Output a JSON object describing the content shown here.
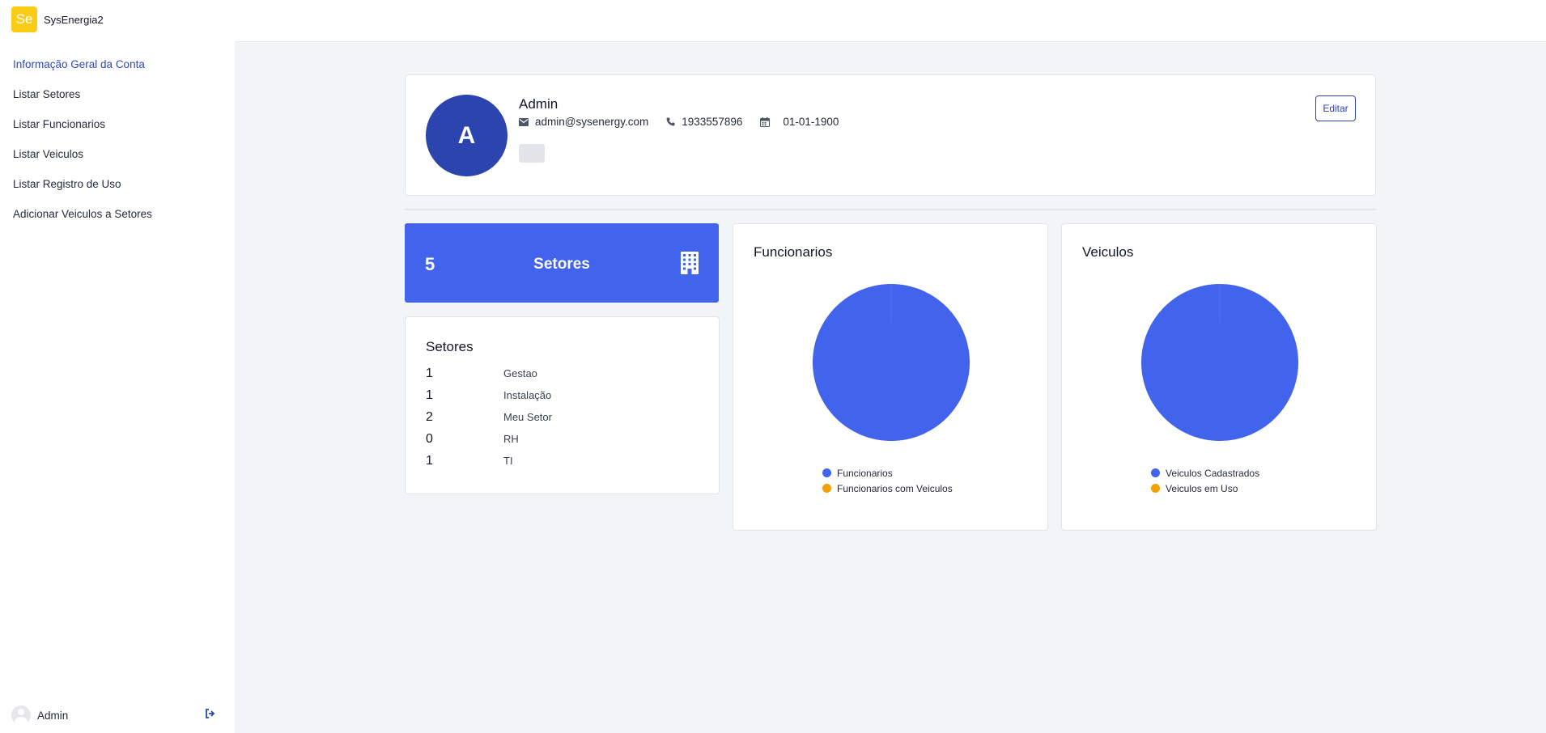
{
  "app": {
    "logo_text": "Se",
    "name": "SysEnergia2"
  },
  "sidebar": {
    "items": [
      {
        "label": "Informação Geral da Conta",
        "active": true
      },
      {
        "label": "Listar Setores"
      },
      {
        "label": "Listar Funcionarios"
      },
      {
        "label": "Listar Veiculos"
      },
      {
        "label": "Listar Registro de Uso"
      },
      {
        "label": "Adicionar Veiculos a Setores"
      }
    ],
    "user": {
      "name": "Admin",
      "icon": "user-avatar-icon",
      "logout_icon": "sign-out-icon"
    }
  },
  "profile": {
    "avatar_letter": "A",
    "name": "Admin",
    "email": "admin@sysenergy.com",
    "phone": "1933557896",
    "date": "01-01-1900",
    "edit_label": "Editar"
  },
  "stat": {
    "value": "5",
    "label": "Setores",
    "icon": "building-icon"
  },
  "sectors": {
    "title": "Setores",
    "rows": [
      {
        "count": "1",
        "name": "Gestao"
      },
      {
        "count": "1",
        "name": "Instalação"
      },
      {
        "count": "2",
        "name": "Meu Setor"
      },
      {
        "count": "0",
        "name": "RH"
      },
      {
        "count": "1",
        "name": "TI"
      }
    ]
  },
  "chart_data": [
    {
      "type": "pie",
      "title": "Funcionarios",
      "categories": [
        "Funcionarios",
        "Funcionarios com Veiculos"
      ],
      "values": [
        1,
        0
      ],
      "colors": [
        "#4263eb",
        "#f59f00"
      ],
      "legend": "bottom"
    },
    {
      "type": "pie",
      "title": "Veiculos",
      "categories": [
        "Veiculos Cadastrados",
        "Veiculos em Uso"
      ],
      "values": [
        1,
        0
      ],
      "colors": [
        "#4263eb",
        "#f59f00"
      ],
      "legend": "bottom"
    }
  ],
  "colors": {
    "primary": "#4263eb",
    "accent": "#2c44ad",
    "logo": "#facc15",
    "secondary": "#f59f00"
  }
}
